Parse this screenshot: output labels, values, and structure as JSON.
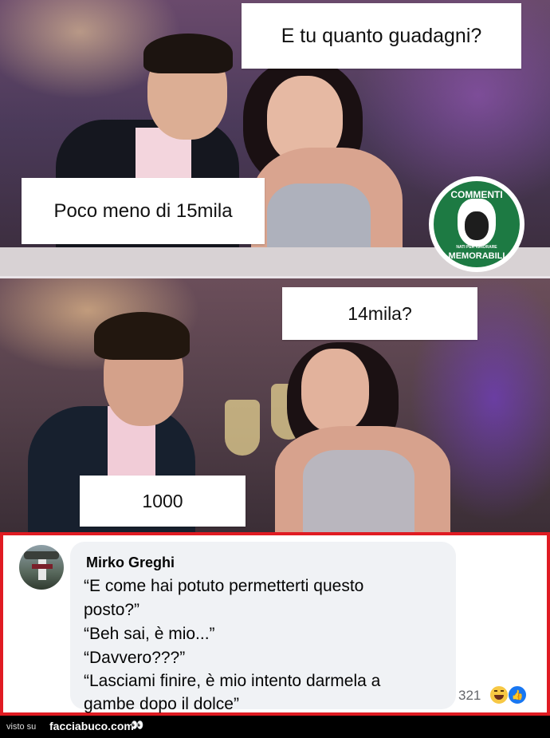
{
  "panels": {
    "top": {
      "caption_question": "E tu quanto guadagni?",
      "caption_answer": "Poco meno di 15mila"
    },
    "bottom": {
      "caption_question": "14mila?",
      "caption_answer": "1000"
    }
  },
  "logo": {
    "line1": "COMMENTI",
    "line2": "MEMORABILI",
    "small": "NATI PER IGNORARE"
  },
  "comment": {
    "author": "Mirko Greghi",
    "lines": [
      "“E come hai potuto permetterti questo",
      "posto?”",
      "“Beh sai, è mio...”",
      "“Davvero???”",
      "“Lasciami finire, è mio intento darmela a",
      "gambe dopo il dolce”"
    ],
    "reaction_count": "321"
  },
  "footer": {
    "visto_su": "visto su",
    "brand": "facciabuco.com",
    "eyes": "👀"
  },
  "colors": {
    "frame_border": "#e01b22",
    "bubble_bg": "#f0f2f5",
    "logo_green": "#1d7a43",
    "like_blue": "#1877f2"
  }
}
